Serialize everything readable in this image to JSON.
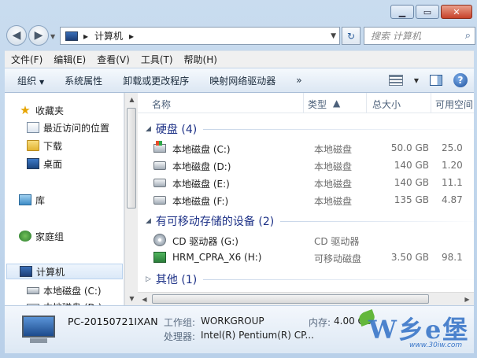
{
  "window": {
    "caption_buttons": [
      "minimize",
      "maximize",
      "close"
    ]
  },
  "nav": {
    "breadcrumb": [
      "计算机"
    ],
    "search_placeholder": "搜索 计算机"
  },
  "menu": [
    "文件(F)",
    "编辑(E)",
    "查看(V)",
    "工具(T)",
    "帮助(H)"
  ],
  "toolbar": {
    "organize": "组织",
    "system_properties": "系统属性",
    "uninstall": "卸载或更改程序",
    "map_drive": "映射网络驱动器",
    "more": "»"
  },
  "sidebar": {
    "favorites": "收藏夹",
    "recent": "最近访问的位置",
    "downloads": "下载",
    "desktop": "桌面",
    "libraries": "库",
    "homegroup": "家庭组",
    "computer": "计算机",
    "drive_c": "本地磁盘 (C:)",
    "drive_d": "本地磁盘 (D:)"
  },
  "columns": {
    "name": "名称",
    "type": "类型",
    "total": "总大小",
    "free": "可用空间"
  },
  "groups": {
    "hdd": "硬盘 (4)",
    "removable": "有可移动存储的设备 (2)",
    "other": "其他 (1)"
  },
  "hdd_rows": [
    {
      "name": "本地磁盘 (C:)",
      "type": "本地磁盘",
      "total": "50.0 GB",
      "free": "25.0",
      "icon": "system-drive-icon"
    },
    {
      "name": "本地磁盘 (D:)",
      "type": "本地磁盘",
      "total": "140 GB",
      "free": "1.20",
      "icon": "drive-icon"
    },
    {
      "name": "本地磁盘 (E:)",
      "type": "本地磁盘",
      "total": "140 GB",
      "free": "11.1",
      "icon": "drive-icon"
    },
    {
      "name": "本地磁盘 (F:)",
      "type": "本地磁盘",
      "total": "135 GB",
      "free": "4.87",
      "icon": "drive-icon"
    }
  ],
  "removable_rows": [
    {
      "name": "CD 驱动器 (G:)",
      "type": "CD 驱动器",
      "total": "",
      "free": "",
      "icon": "cd-drive-icon"
    },
    {
      "name": "HRM_CPRA_X6 (H:)",
      "type": "可移动磁盘",
      "total": "3.50 GB",
      "free": "98.1",
      "icon": "usb-drive-icon"
    }
  ],
  "details": {
    "computer_name": "PC-20150721IXAN",
    "workgroup_label": "工作组:",
    "workgroup_value": "WORKGROUP",
    "memory_label": "内存:",
    "memory_value": "4.00 GB",
    "cpu_label": "处理器:",
    "cpu_value": "Intel(R) Pentium(R) CP..."
  },
  "watermark": {
    "logo_text": "W乡e堡",
    "url": "www.30iw.com"
  }
}
